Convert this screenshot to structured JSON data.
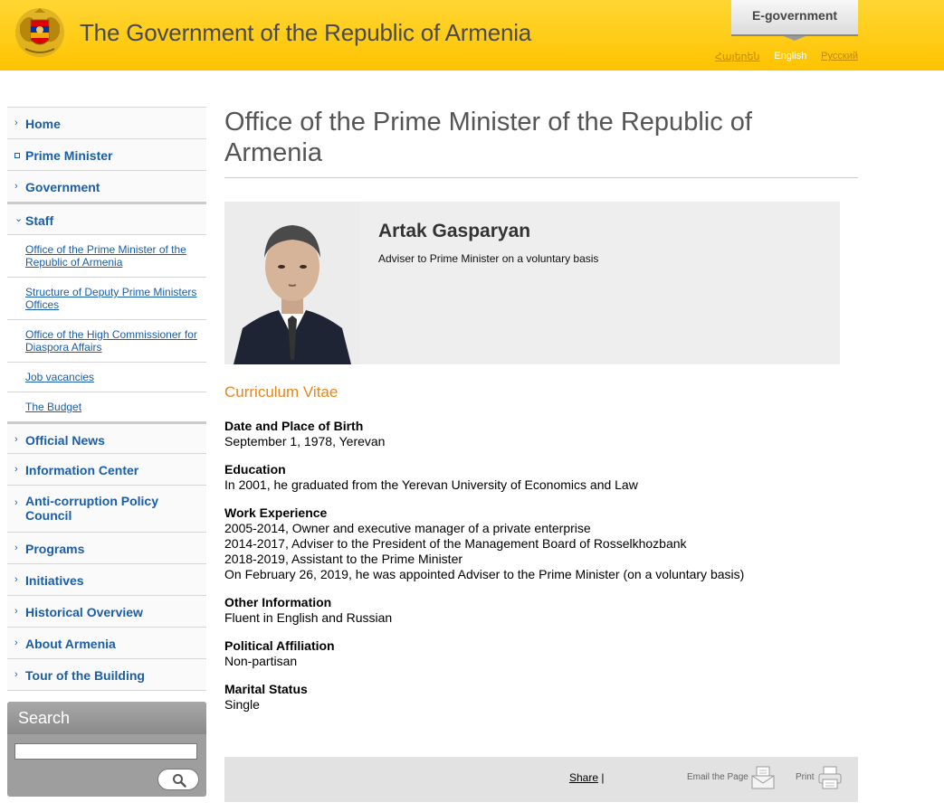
{
  "header": {
    "site_title": "The Government of the Republic of Armenia",
    "egov_label": "E-government",
    "languages": [
      "Հայերեն",
      "English",
      "Русский"
    ]
  },
  "sidebar": {
    "items": [
      {
        "label": "Home"
      },
      {
        "label": "Prime Minister"
      },
      {
        "label": "Government"
      },
      {
        "label": "Staff"
      }
    ],
    "staff_sub": [
      {
        "label": "Office of the Prime Minister of the Republic of Armenia"
      },
      {
        "label": "Structure of Deputy Prime Ministers Offices"
      },
      {
        "label": "Office of the High Commissioner for Diaspora Affairs"
      },
      {
        "label": "Job vacancies"
      },
      {
        "label": "The Budget"
      }
    ],
    "items_after": [
      {
        "label": "Official News"
      },
      {
        "label": "Information Center"
      },
      {
        "label": "Anti-corruption Policy Council"
      },
      {
        "label": "Programs"
      },
      {
        "label": "Initiatives"
      },
      {
        "label": "Historical Overview"
      },
      {
        "label": "About Armenia"
      },
      {
        "label": "Tour of the Building"
      }
    ]
  },
  "search": {
    "title": "Search",
    "value": ""
  },
  "main": {
    "page_title": "Office of the Prime Minister of the Republic of Armenia",
    "person_name": "Artak Gasparyan",
    "person_role": "Adviser to Prime Minister on a voluntary basis",
    "cv_title": "Curriculum Vitae",
    "cv": [
      {
        "label": "Date and Place of Birth",
        "lines": [
          "September 1, 1978, Yerevan"
        ]
      },
      {
        "label": "Education",
        "lines": [
          "In 2001, he graduated from the Yerevan University of Economics and Law"
        ]
      },
      {
        "label": "Work Experience",
        "lines": [
          "2005-2014, Owner and executive manager of a private enterprise",
          "2014-2017, Adviser to the President of the Management Board of Rosselkhozbank",
          "2018-2019, Assistant to the Prime Minister",
          "On February 26, 2019, he was appointed Adviser to the Prime Minister (on a voluntary basis)"
        ]
      },
      {
        "label": "Other Information",
        "lines": [
          "Fluent in English and Russian"
        ]
      },
      {
        "label": "Political Affiliation",
        "lines": [
          "Non-partisan"
        ]
      },
      {
        "label": "Marital Status",
        "lines": [
          "Single"
        ]
      }
    ]
  },
  "footer": {
    "share_label": "Share",
    "share_sep": "|",
    "email_label": "Email the Page",
    "print_label": "Print"
  }
}
